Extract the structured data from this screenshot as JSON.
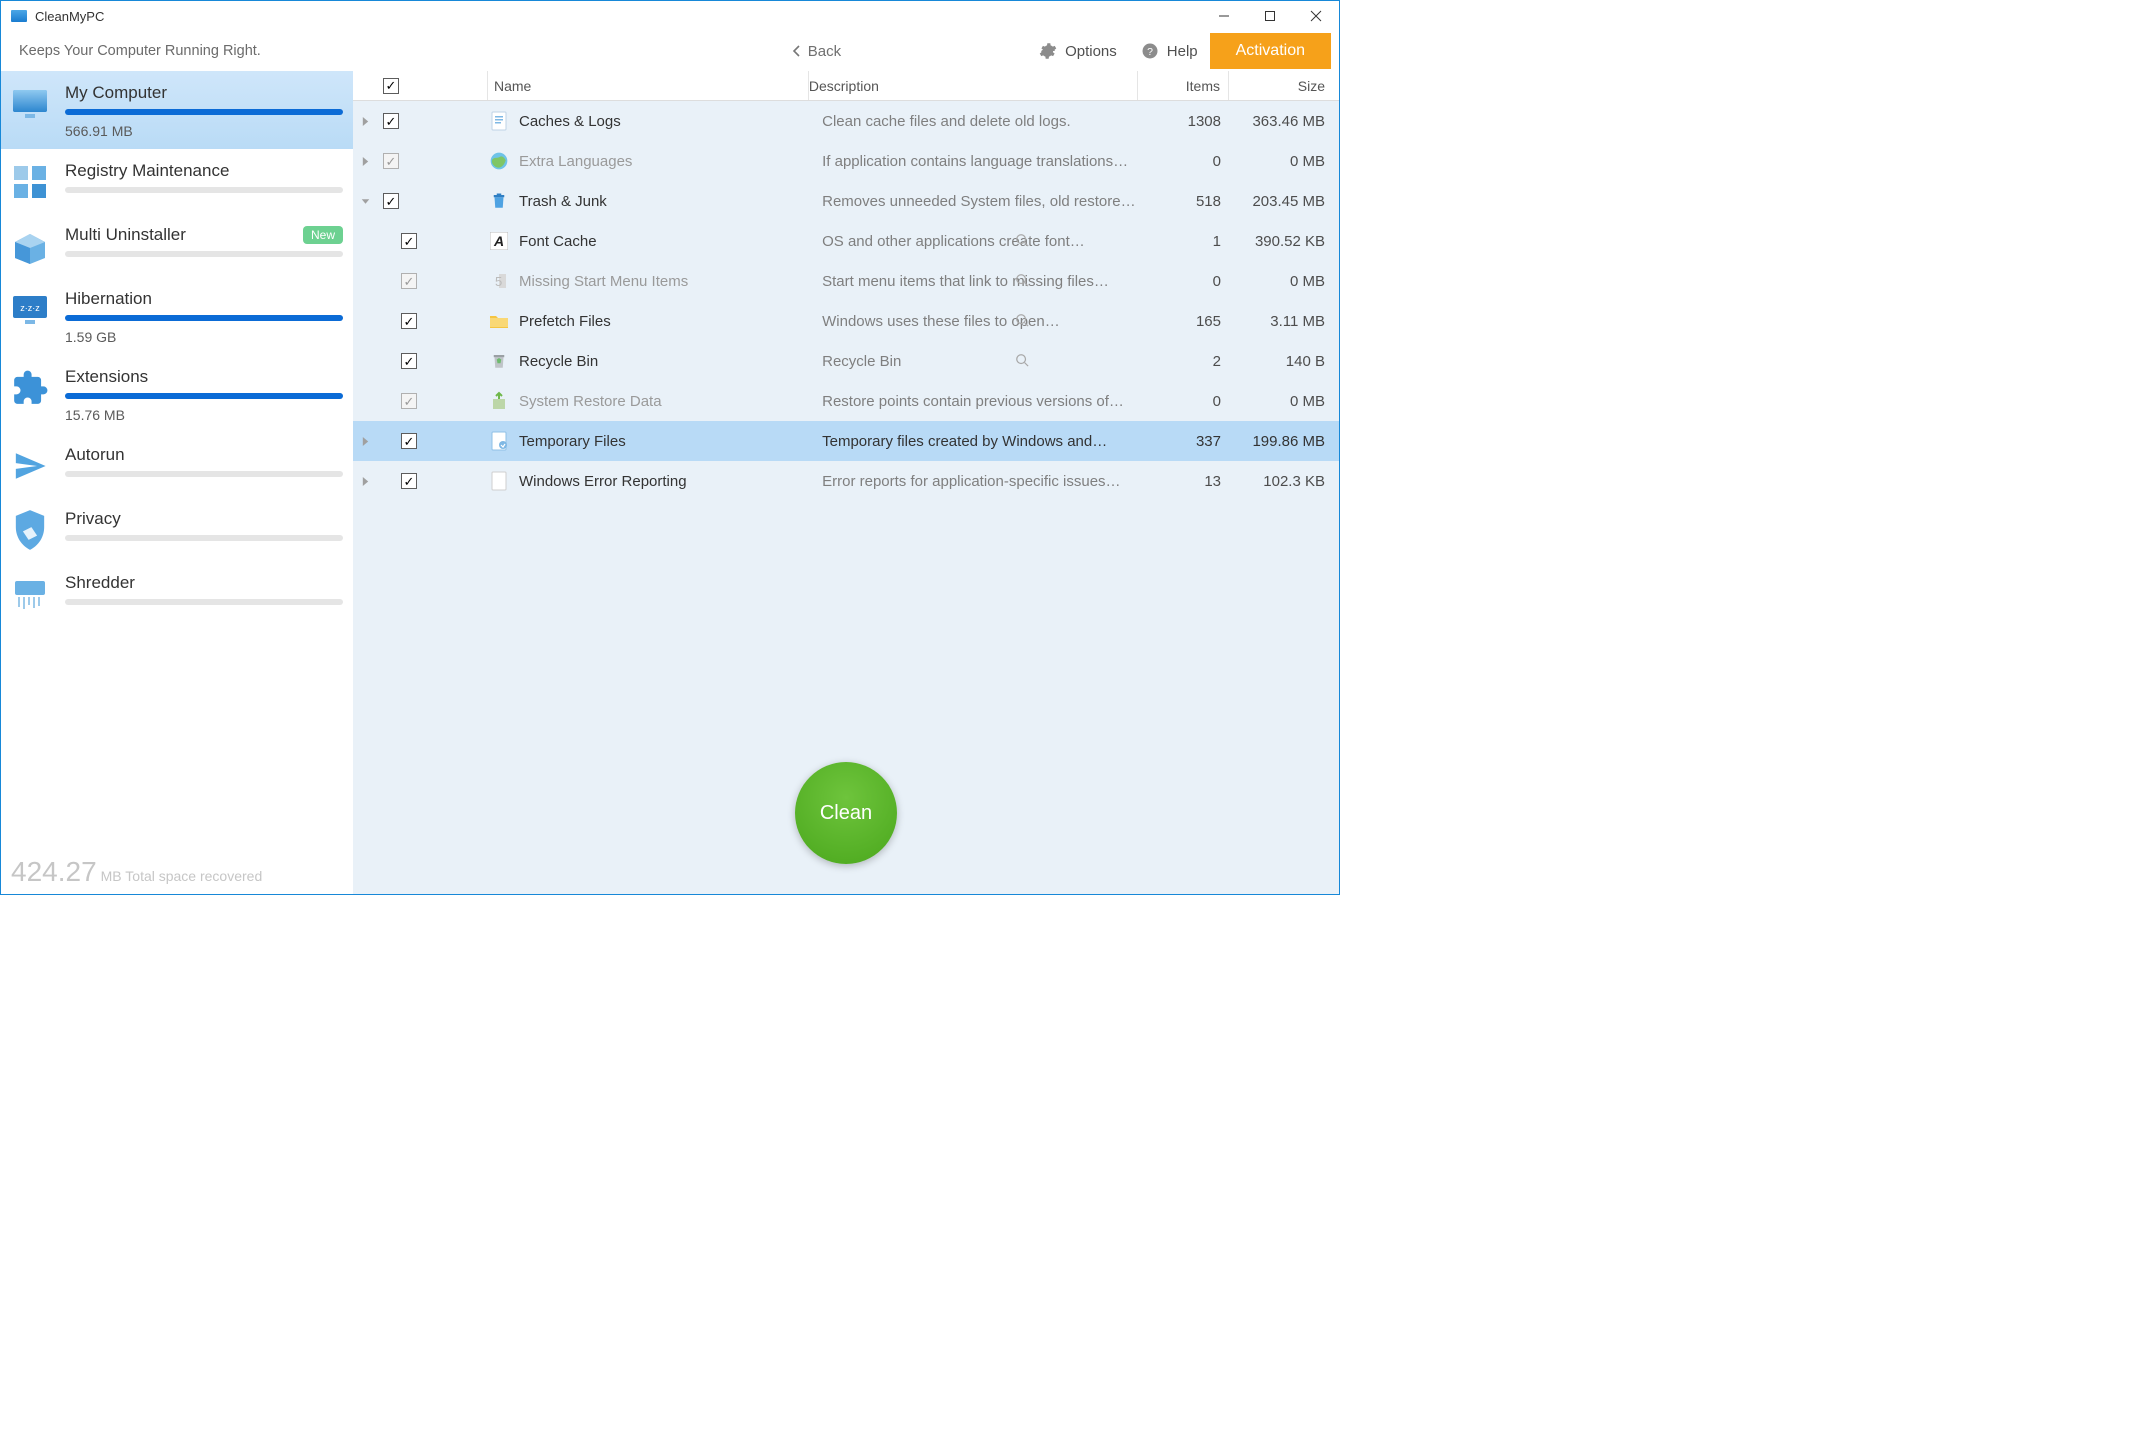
{
  "app": {
    "title": "CleanMyPC",
    "tagline": "Keeps Your Computer Running Right."
  },
  "header": {
    "back": "Back",
    "options": "Options",
    "help": "Help",
    "activation": "Activation"
  },
  "sidebar": {
    "items": [
      {
        "label": "My Computer",
        "sub": "566.91 MB",
        "fill": 100,
        "icon": "monitor"
      },
      {
        "label": "Registry Maintenance",
        "sub": "",
        "fill": 0,
        "icon": "registry"
      },
      {
        "label": "Multi Uninstaller",
        "sub": "",
        "fill": 0,
        "icon": "box",
        "badge": "New"
      },
      {
        "label": "Hibernation",
        "sub": "1.59 GB",
        "fill": 100,
        "icon": "sleep"
      },
      {
        "label": "Extensions",
        "sub": "15.76 MB",
        "fill": 100,
        "icon": "puzzle"
      },
      {
        "label": "Autorun",
        "sub": "",
        "fill": 0,
        "icon": "plane"
      },
      {
        "label": "Privacy",
        "sub": "",
        "fill": 0,
        "icon": "shield"
      },
      {
        "label": "Shredder",
        "sub": "",
        "fill": 0,
        "icon": "shredder"
      }
    ]
  },
  "footer": {
    "number": "424.27",
    "text": "MB Total space recovered"
  },
  "table": {
    "headers": {
      "name": "Name",
      "description": "Description",
      "items": "Items",
      "size": "Size"
    },
    "rows": [
      {
        "name": "Caches & Logs",
        "desc": "Clean cache files and delete old logs.",
        "items": "1308",
        "size": "363.46 MB",
        "icon": "doc",
        "disclosure": "right",
        "checked": true,
        "checkStyle": "normal",
        "level": 0,
        "dimmed": false,
        "selected": false,
        "magnify": false
      },
      {
        "name": "Extra Languages",
        "desc": "If application contains language translations…",
        "items": "0",
        "size": "0 MB",
        "icon": "globe",
        "disclosure": "right",
        "checked": true,
        "checkStyle": "dim",
        "level": 0,
        "dimmed": true,
        "selected": false,
        "magnify": false
      },
      {
        "name": "Trash & Junk",
        "desc": "Removes unneeded System files, old restore…",
        "items": "518",
        "size": "203.45 MB",
        "icon": "trash-blue",
        "disclosure": "down",
        "checked": true,
        "checkStyle": "normal",
        "level": 0,
        "dimmed": false,
        "selected": false,
        "magnify": false
      },
      {
        "name": "Font Cache",
        "desc": "OS and other applications create font…",
        "items": "1",
        "size": "390.52 KB",
        "icon": "font",
        "disclosure": "none",
        "checked": true,
        "checkStyle": "normal",
        "level": 1,
        "dimmed": false,
        "selected": false,
        "magnify": true
      },
      {
        "name": "Missing Start Menu Items",
        "desc": "Start menu items that link to missing files…",
        "items": "0",
        "size": "0 MB",
        "icon": "startmenu",
        "disclosure": "none",
        "checked": true,
        "checkStyle": "dim",
        "level": 1,
        "dimmed": true,
        "selected": false,
        "magnify": true
      },
      {
        "name": "Prefetch Files",
        "desc": "Windows uses these files to open…",
        "items": "165",
        "size": "3.11 MB",
        "icon": "folder",
        "disclosure": "none",
        "checked": true,
        "checkStyle": "normal",
        "level": 1,
        "dimmed": false,
        "selected": false,
        "magnify": true
      },
      {
        "name": " Recycle Bin",
        "desc": "Recycle Bin",
        "items": "2",
        "size": "140 B",
        "icon": "recycle",
        "disclosure": "none",
        "checked": true,
        "checkStyle": "normal",
        "level": 1,
        "dimmed": false,
        "selected": false,
        "magnify": true
      },
      {
        "name": "System Restore Data",
        "desc": "Restore points contain previous versions of…",
        "items": "0",
        "size": "0 MB",
        "icon": "restore",
        "disclosure": "none",
        "checked": true,
        "checkStyle": "dim",
        "level": 1,
        "dimmed": true,
        "selected": false,
        "magnify": false
      },
      {
        "name": "Temporary Files",
        "desc": "Temporary files created by Windows and…",
        "items": "337",
        "size": "199.86 MB",
        "icon": "temp",
        "disclosure": "right",
        "checked": true,
        "checkStyle": "normal",
        "level": 1,
        "dimmed": false,
        "selected": true,
        "magnify": false
      },
      {
        "name": "Windows Error Reporting",
        "desc": "Error reports for application-specific issues…",
        "items": "13",
        "size": "102.3 KB",
        "icon": "doc-blank",
        "disclosure": "right",
        "checked": true,
        "checkStyle": "normal",
        "level": 1,
        "dimmed": false,
        "selected": false,
        "magnify": false
      }
    ]
  },
  "clean": "Clean"
}
